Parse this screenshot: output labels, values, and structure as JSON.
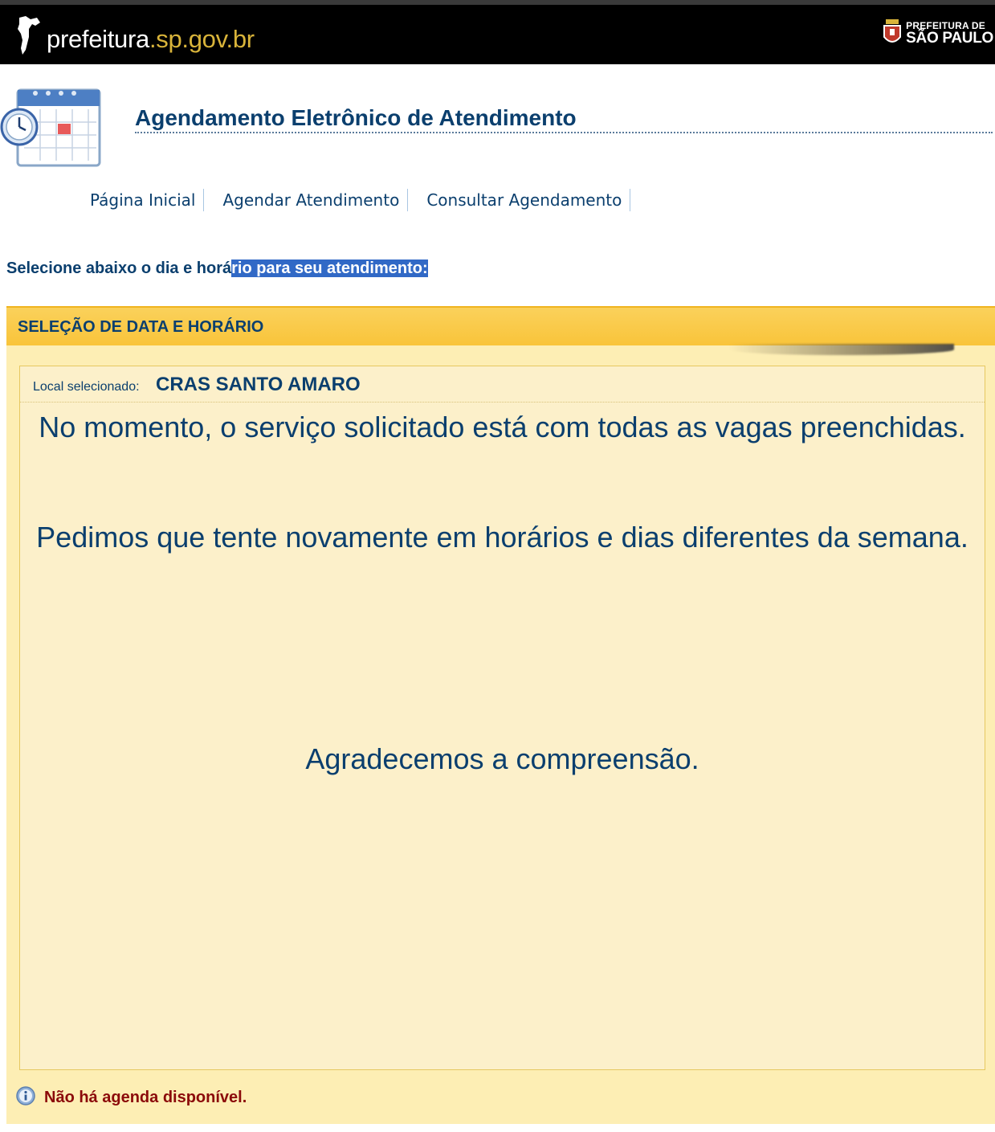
{
  "topbar": {
    "site_name_main": "prefeitura",
    "site_name_domain": ".sp.gov.br",
    "city_logo_line1": "PREFEITURA DE",
    "city_logo_line2": "SÃO PAULO"
  },
  "header": {
    "title": "Agendamento Eletrônico de Atendimento",
    "icon": "calendar-clock-icon"
  },
  "nav": {
    "items": [
      {
        "label": "Página Inicial"
      },
      {
        "label": "Agendar Atendimento"
      },
      {
        "label": "Consultar Agendamento"
      }
    ]
  },
  "instruction": {
    "text_plain": "Selecione abaixo o dia e horá",
    "text_selected": "rio para seu atendimento:"
  },
  "panel": {
    "title": "SELEÇÃO DE DATA E HORÁRIO",
    "local_label": "Local selecionado:",
    "local_value": "CRAS SANTO AMARO",
    "message1": "No momento, o serviço solicitado está com todas as vagas preenchidas.",
    "message2": "Pedimos que tente novamente em horários e dias diferentes da semana.",
    "message3": "Agradecemos a compreensão.",
    "notice": "Não há agenda disponível.",
    "notice_icon": "info-icon"
  },
  "colors": {
    "primary_text": "#0b3f6e",
    "panel_header": "#f9c43a",
    "panel_bg": "#fdeeb4",
    "notice_text": "#8b0a0a",
    "selection": "#3169c6"
  }
}
